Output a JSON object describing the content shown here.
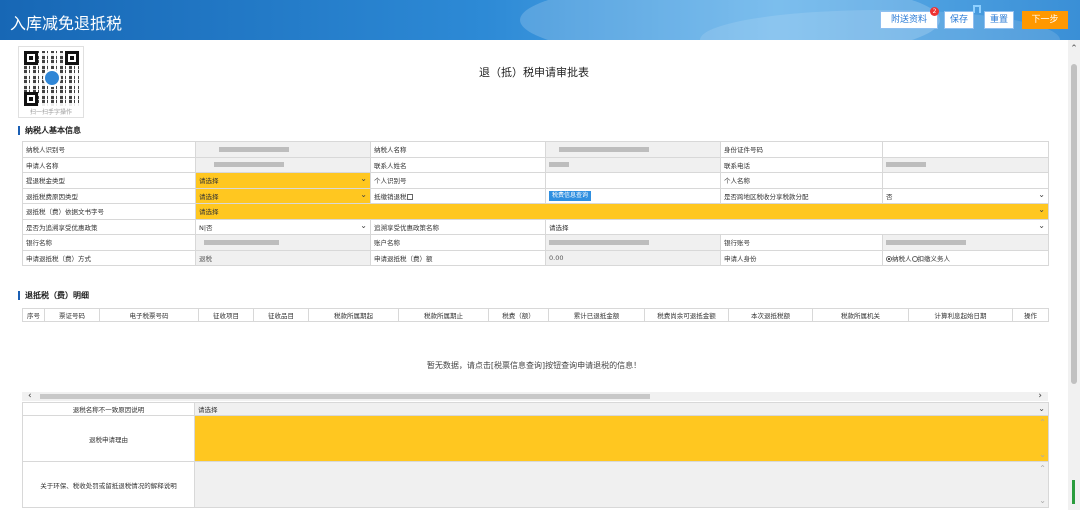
{
  "header": {
    "title": "入库减免退抵税",
    "buttons": {
      "send": "附送资料",
      "save": "保存",
      "reset": "重置",
      "next": "下一步"
    },
    "badge": "2"
  },
  "qr": {
    "caption": "扫一扫手字操作"
  },
  "form_title": "退（抵）税申请审批表",
  "basic_section": {
    "title": "纳税人基本信息",
    "rows": [
      {
        "l1": "纳税人识别号",
        "l2": "纳税人名称",
        "l3": "身份证件号码"
      },
      {
        "l1": "申请人名称",
        "l2": "联系人姓名",
        "l3": "联系电话"
      },
      {
        "l1": "提退税金类型",
        "v1": "请选择",
        "l2": "个人识别号",
        "l3": "个人名称"
      },
      {
        "l1": "退抵税费原因类型",
        "v1": "请选择",
        "l2": "抵缴销退税",
        "btn": "税费信息查询",
        "l3": "是否跨地区税收分享税款分配",
        "v3": "否"
      },
      {
        "l1": "退抵税（费）依据文书字号",
        "v1": "请选择"
      },
      {
        "l1": "是否为追溯享受优惠政策",
        "v1": "N|否",
        "l2": "追溯享受优惠政策名称",
        "v2": "请选择"
      },
      {
        "l1": "银行名称",
        "l2": "账户名称",
        "l3": "银行账号"
      },
      {
        "l1": "申请退抵税（费）方式",
        "v1": "退税",
        "l2": "申请退抵税（费）额",
        "v2": "0.00",
        "l3": "申请人身份",
        "opt1": "纳税人",
        "opt2": "扣缴义务人"
      }
    ]
  },
  "detail_section": {
    "title": "退抵税（费）明细",
    "columns": [
      "序号",
      "票证号码",
      "电子税票号码",
      "征收项目",
      "征收品目",
      "税款所属期起",
      "税款所属期止",
      "税费（额）",
      "累计已退抵金额",
      "税费尚余可退抵金额",
      "本次退抵税额",
      "税款所属机关",
      "计算利息起始日期",
      "操作"
    ],
    "empty_message": "暂无数据，请点击[税票信息查询]按钮查询申请退税的信息！"
  },
  "bottom_section": {
    "r1_label": "退税名称不一致原因说明",
    "r1_value": "请选择",
    "r2_label": "退税申请理由",
    "r3_label": "关于环保、税收处罚或留抵退税情况的解释说明"
  },
  "colors": {
    "accent": "#1a5fb4",
    "yellow": "#ffc720",
    "next_button": "#ff9800",
    "query_button": "#2f8fe0"
  }
}
